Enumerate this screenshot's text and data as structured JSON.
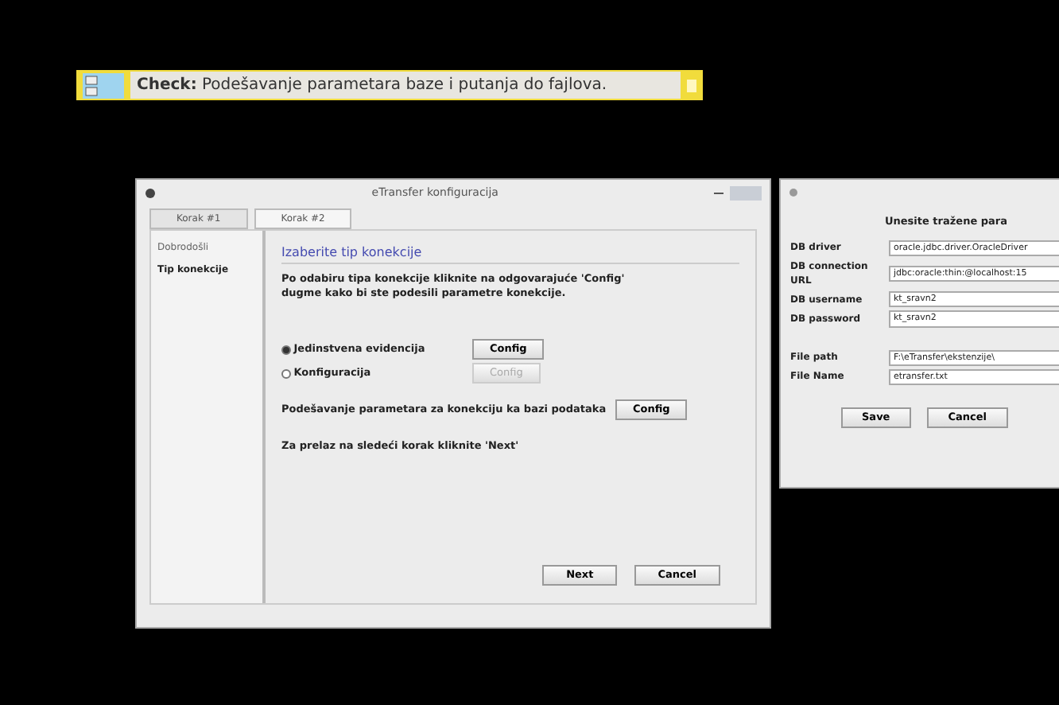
{
  "banner": {
    "text": "**Check:** Podešavanje parametara baze i putanja do fajlova."
  },
  "main_window": {
    "title": "eTransfer konfiguracija",
    "tabs": [
      {
        "label": "Korak #1",
        "selected": false
      },
      {
        "label": "Korak #2",
        "selected": true
      }
    ],
    "sidebar": {
      "items": [
        {
          "label": "Dobrodošli",
          "selected": false
        },
        {
          "label": "Tip konekcije",
          "selected": true
        }
      ]
    },
    "heading": "Izaberite tip konekcije",
    "description": "Po odabiru tipa konekcije kliknite na odgovarajuće 'Config' dugme kako bi ste podesili parametre konekcije.",
    "options": [
      {
        "label": "Jedinstvena evidencija",
        "selected": true,
        "button": "Config",
        "disabled": false
      },
      {
        "label": "Konfiguracija",
        "selected": false,
        "button": "Config",
        "disabled": true
      }
    ],
    "extra_row": {
      "label": "Podešavanje parametara za konekciju ka bazi podataka",
      "button": "Config"
    },
    "hint": "Za prelaz na sledeći korak kliknite 'Next'",
    "buttons": [
      "Next",
      "Cancel"
    ]
  },
  "side_window": {
    "heading": "Unesite tražene para",
    "fields": [
      {
        "label": "DB driver",
        "value": "oracle.jdbc.driver.OracleDriver"
      },
      {
        "label": "DB connection URL",
        "value": "jdbc:oracle:thin:@localhost:15"
      },
      {
        "label": "DB username",
        "value": "kt_sravn2"
      },
      {
        "label": "DB password",
        "value": "kt_sravn2"
      },
      {
        "label": "File path",
        "value": "F:\\eTransfer\\ekstenzije\\"
      },
      {
        "label": "File Name",
        "value": "etransfer.txt"
      }
    ],
    "buttons": [
      "Save",
      "Cancel"
    ]
  }
}
